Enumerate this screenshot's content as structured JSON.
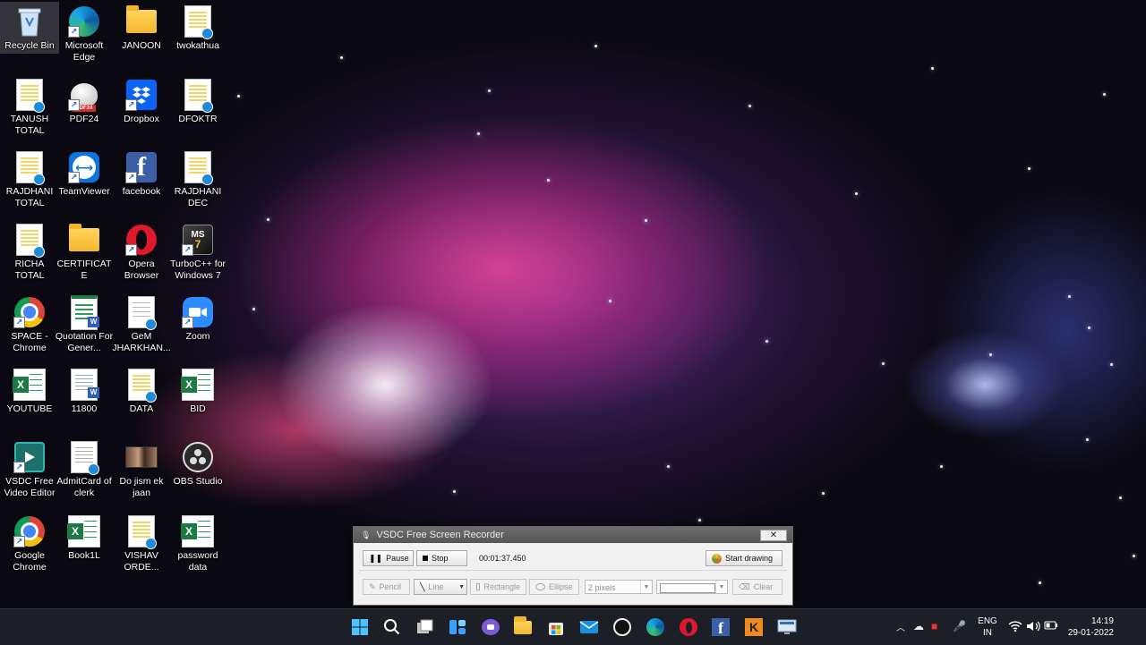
{
  "desktop": {
    "icons": [
      {
        "label": "Recycle Bin",
        "icon": "recycle-bin-icon"
      },
      {
        "label": "Microsoft Edge",
        "icon": "edge-icon"
      },
      {
        "label": "JANOON",
        "icon": "folder-icon"
      },
      {
        "label": "twokathua",
        "icon": "document-icon"
      },
      {
        "label": "TANUSH TOTAL",
        "icon": "document-icon"
      },
      {
        "label": "PDF24",
        "icon": "pdf24-icon"
      },
      {
        "label": "Dropbox",
        "icon": "dropbox-icon"
      },
      {
        "label": "DFOKTR",
        "icon": "document-icon"
      },
      {
        "label": "RAJDHANI TOTAL",
        "icon": "document-icon"
      },
      {
        "label": "TeamViewer",
        "icon": "teamviewer-icon"
      },
      {
        "label": "facebook",
        "icon": "facebook-icon"
      },
      {
        "label": "RAJDHANI DEC",
        "icon": "document-icon"
      },
      {
        "label": "RICHA TOTAL",
        "icon": "document-icon"
      },
      {
        "label": "CERTIFICATE",
        "icon": "folder-icon"
      },
      {
        "label": "Opera Browser",
        "icon": "opera-icon"
      },
      {
        "label": "TurboC++ for Windows 7",
        "icon": "turbocpp-icon"
      },
      {
        "label": "SPACE - Chrome",
        "icon": "chrome-icon"
      },
      {
        "label": "Quotation For Gener...",
        "icon": "word-document-icon"
      },
      {
        "label": "GeM JHARKHAN...",
        "icon": "document-icon"
      },
      {
        "label": "Zoom",
        "icon": "zoom-icon"
      },
      {
        "label": "YOUTUBE",
        "icon": "excel-icon"
      },
      {
        "label": "11800",
        "icon": "word-document-icon"
      },
      {
        "label": "DATA",
        "icon": "document-icon"
      },
      {
        "label": "BID",
        "icon": "excel-icon"
      },
      {
        "label": "VSDC Free Video Editor",
        "icon": "vsdc-icon"
      },
      {
        "label": "AdmitCard of clerk",
        "icon": "document-icon"
      },
      {
        "label": "Do jism ek jaan",
        "icon": "video-thumbnail-icon"
      },
      {
        "label": "OBS Studio",
        "icon": "obs-icon"
      },
      {
        "label": "Google Chrome",
        "icon": "chrome-icon"
      },
      {
        "label": "Book1L",
        "icon": "excel-icon"
      },
      {
        "label": "VISHAV ORDE...",
        "icon": "document-icon"
      },
      {
        "label": "password data",
        "icon": "excel-icon"
      }
    ]
  },
  "recorder": {
    "title": "VSDC Free Screen Recorder",
    "close_label": "✕",
    "pause_label": "Pause",
    "stop_label": "Stop",
    "timer": "00:01:37.450",
    "start_drawing_label": "Start drawing",
    "pencil_label": "Pencil",
    "line_label": "Line",
    "rectangle_label": "Rectangle",
    "ellipse_label": "Ellipse",
    "stroke_width": "2 pixels",
    "clear_label": "Clear"
  },
  "taskbar": {
    "apps": [
      "windows-start-icon",
      "search-icon",
      "task-view-icon",
      "widgets-icon",
      "chat-icon",
      "file-explorer-icon",
      "store-icon",
      "mail-icon",
      "obs-icon",
      "edge-icon",
      "opera-icon",
      "facebook-icon",
      "kinemaster-icon",
      "remote-desktop-icon"
    ],
    "lang_line1": "ENG",
    "lang_line2": "IN",
    "time": "14:19",
    "date": "29-01-2022"
  },
  "colors": {
    "taskbar_bg": "#1d1f26",
    "recorder_title_bg": "#5f5f5f",
    "accent_blue": "#1f8bd8"
  }
}
